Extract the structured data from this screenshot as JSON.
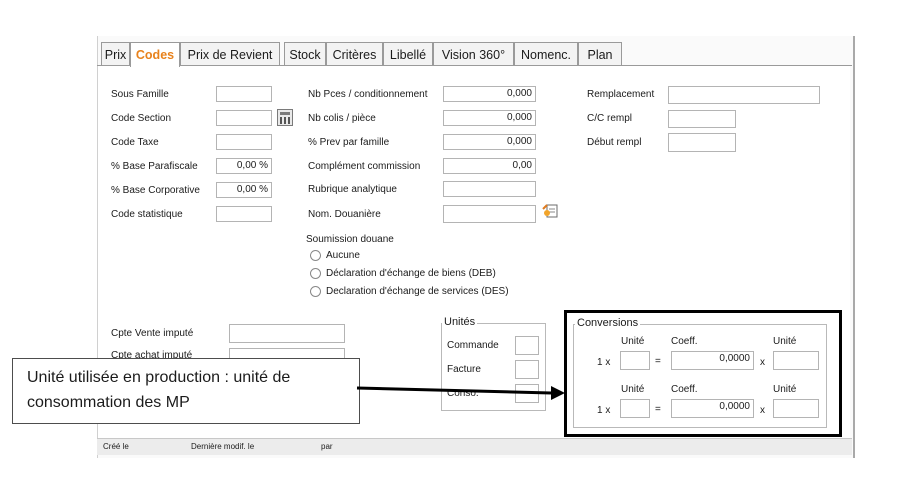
{
  "tabs": [
    {
      "label": "Prix"
    },
    {
      "label": "Codes"
    },
    {
      "label": "Prix de Revient"
    },
    {
      "label": "Stock"
    },
    {
      "label": "Critères"
    },
    {
      "label": "Libellé"
    },
    {
      "label": "Vision 360°"
    },
    {
      "label": "Nomenc."
    },
    {
      "label": "Plan"
    }
  ],
  "col1": {
    "sous_famille": "Sous Famille",
    "code_section": "Code Section",
    "code_taxe": "Code Taxe",
    "base_parafiscale": "% Base Parafiscale",
    "base_parafiscale_val": "0,00 %",
    "base_corporative": "% Base Corporative",
    "base_corporative_val": "0,00 %",
    "code_statistique": "Code statistique"
  },
  "col2": {
    "nb_pces": "Nb Pces / conditionnement",
    "nb_pces_val": "0,000",
    "nb_colis": "Nb colis / pièce",
    "nb_colis_val": "0,000",
    "prev_famille": "% Prev par famille",
    "prev_famille_val": "0,000",
    "complement": "Complément commission",
    "complement_val": "0,00",
    "rubrique": "Rubrique analytique",
    "douaniere": "Nom. Douanière"
  },
  "col3": {
    "remplacement": "Remplacement",
    "cc_rempl": "C/C rempl",
    "debut_rempl": "Début rempl"
  },
  "soumission": {
    "title": "Soumission douane",
    "options": [
      "Aucune",
      "Déclaration d'échange de biens (DEB)",
      "Declaration d'échange de services (DES)"
    ]
  },
  "cpte": {
    "vente": "Cpte Vente imputé",
    "achat": "Cpte achat imputé"
  },
  "unites": {
    "title": "Unités",
    "commande": "Commande",
    "facture": "Facture",
    "conso": "Conso."
  },
  "conversions": {
    "title": "Conversions",
    "unite": "Unité",
    "coeff": "Coeff.",
    "one_x": "1 x",
    "equals": "=",
    "times": "x",
    "coeff_val": "0,0000"
  },
  "status": {
    "cree": "Créé le",
    "modif": "Dernière modif. le",
    "par": "par"
  },
  "callout": {
    "line1": "Unité utilisée en production : unité de",
    "line2": "consommation des MP"
  }
}
